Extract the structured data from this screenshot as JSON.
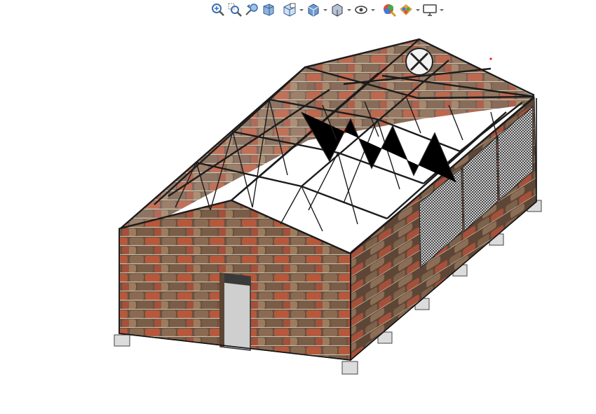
{
  "toolbar": {
    "buttons": [
      {
        "icon": "zoom-to-fit-icon",
        "dropdown": false
      },
      {
        "icon": "zoom-to-area-icon",
        "dropdown": false
      },
      {
        "icon": "previous-view-icon",
        "dropdown": false
      },
      {
        "icon": "section-view-icon",
        "dropdown": false
      },
      {
        "icon": "dynamic-annotation-views-icon",
        "dropdown": true
      },
      {
        "icon": "view-orientation-icon",
        "dropdown": true
      },
      {
        "icon": "display-style-icon",
        "dropdown": true
      },
      {
        "icon": "hide-show-items-icon",
        "dropdown": true
      },
      {
        "icon": "edit-appearance-icon",
        "dropdown": false
      },
      {
        "icon": "apply-scene-icon",
        "dropdown": true
      },
      {
        "icon": "view-settings-icon",
        "dropdown": true
      }
    ]
  },
  "model": {
    "name": "building-model",
    "colors": {
      "brick_base": "#6e5340",
      "brick_red": "#b5583c",
      "mortar": "#c9bda6",
      "steel": "#1c1c1c",
      "footing": "#d9d9d9",
      "door": "#cfcfcf"
    }
  }
}
